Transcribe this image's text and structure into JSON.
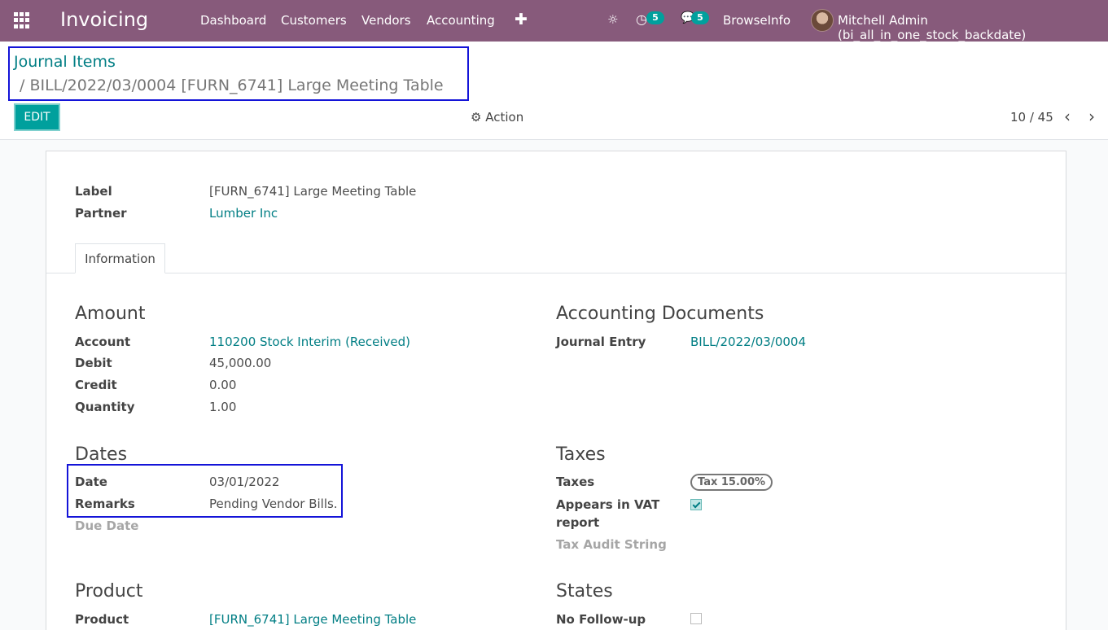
{
  "navbar": {
    "app_name": "Invoicing",
    "menu": [
      "Dashboard",
      "Customers",
      "Vendors",
      "Accounting"
    ],
    "plus_icon": "✚",
    "bug_icon": "☼",
    "activity_icon": "◷",
    "activity_count": "5",
    "messages_icon": "💬",
    "messages_count": "5",
    "company": "BrowseInfo",
    "user": "Mitchell Admin (bi_all_in_one_stock_backdate)"
  },
  "breadcrumb": {
    "parent": "Journal Items",
    "current": "/ BILL/2022/03/0004 [FURN_6741] Large Meeting Table"
  },
  "toolbar": {
    "edit_label": "EDIT",
    "action_label": "Action",
    "pager": "10 / 45",
    "prev_icon": "‹",
    "next_icon": "›"
  },
  "header_fields": {
    "label_label": "Label",
    "label_value": "[FURN_6741] Large Meeting Table",
    "partner_label": "Partner",
    "partner_value": "Lumber Inc"
  },
  "tabs": [
    "Information"
  ],
  "amount": {
    "title": "Amount",
    "account_label": "Account",
    "account_value": "110200 Stock Interim (Received)",
    "debit_label": "Debit",
    "debit_value": "45,000.00",
    "credit_label": "Credit",
    "credit_value": "0.00",
    "quantity_label": "Quantity",
    "quantity_value": "1.00"
  },
  "accounting_documents": {
    "title": "Accounting Documents",
    "journal_entry_label": "Journal Entry",
    "journal_entry_value": "BILL/2022/03/0004"
  },
  "dates": {
    "title": "Dates",
    "date_label": "Date",
    "date_value": "03/01/2022",
    "remarks_label": "Remarks",
    "remarks_value": "Pending Vendor Bills.",
    "due_date_label": "Due Date"
  },
  "taxes": {
    "title": "Taxes",
    "taxes_label": "Taxes",
    "tax_tag": "Tax 15.00%",
    "vat_label_line1": "Appears in VAT",
    "vat_label_line2": "report",
    "vat_checked": true,
    "audit_label": "Tax Audit String"
  },
  "product": {
    "title": "Product",
    "product_label": "Product",
    "product_value": "[FURN_6741] Large Meeting Table"
  },
  "states": {
    "title": "States",
    "no_followup_label": "No Follow-up",
    "no_followup_checked": false
  },
  "colors": {
    "navbar": "#875a7b",
    "accent": "#00a09d",
    "link": "#017e84",
    "highlight_box": "#1414d8"
  }
}
